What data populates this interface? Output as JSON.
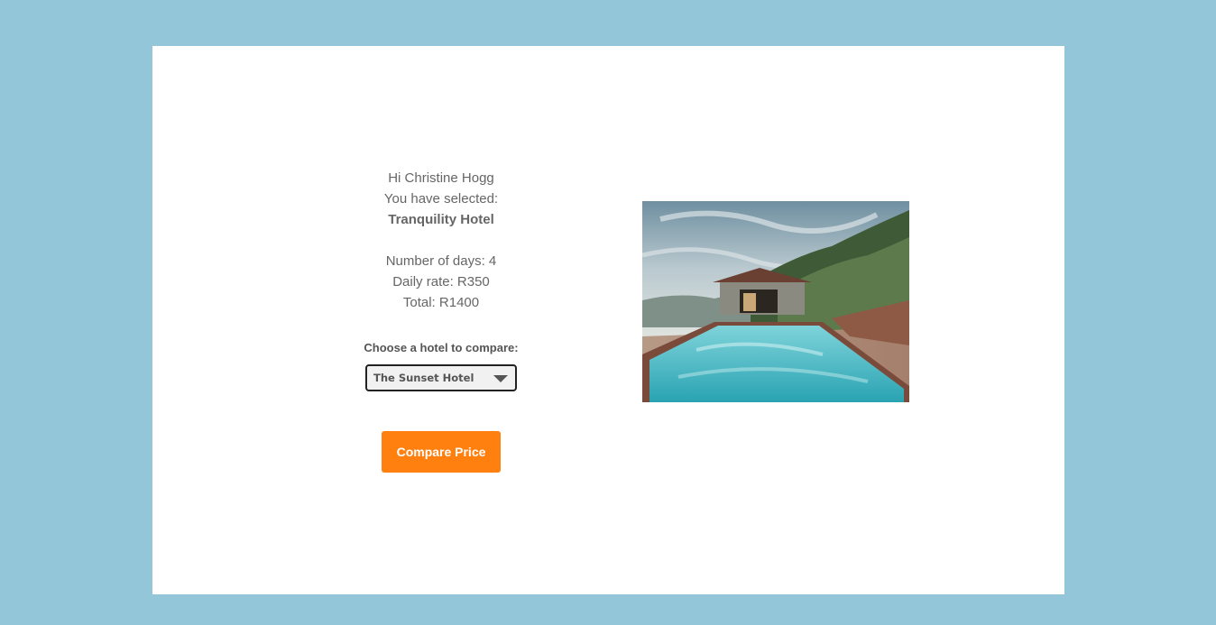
{
  "greeting": "Hi Christine Hogg",
  "selected_prefix": "You have selected:",
  "selected_hotel": "Tranquility Hotel",
  "days_text": "Number of days: 4",
  "rate_text": "Daily rate: R350",
  "total_text": "Total: R1400",
  "compare": {
    "label": "Choose a hotel to compare:",
    "selected_option": "The Sunset Hotel",
    "button_label": "Compare Price"
  },
  "colors": {
    "background": "#94c6da",
    "card": "#ffffff",
    "accent": "#ff7f0f",
    "text": "#666666"
  },
  "icons": {
    "dropdown": "caret-down-icon"
  }
}
